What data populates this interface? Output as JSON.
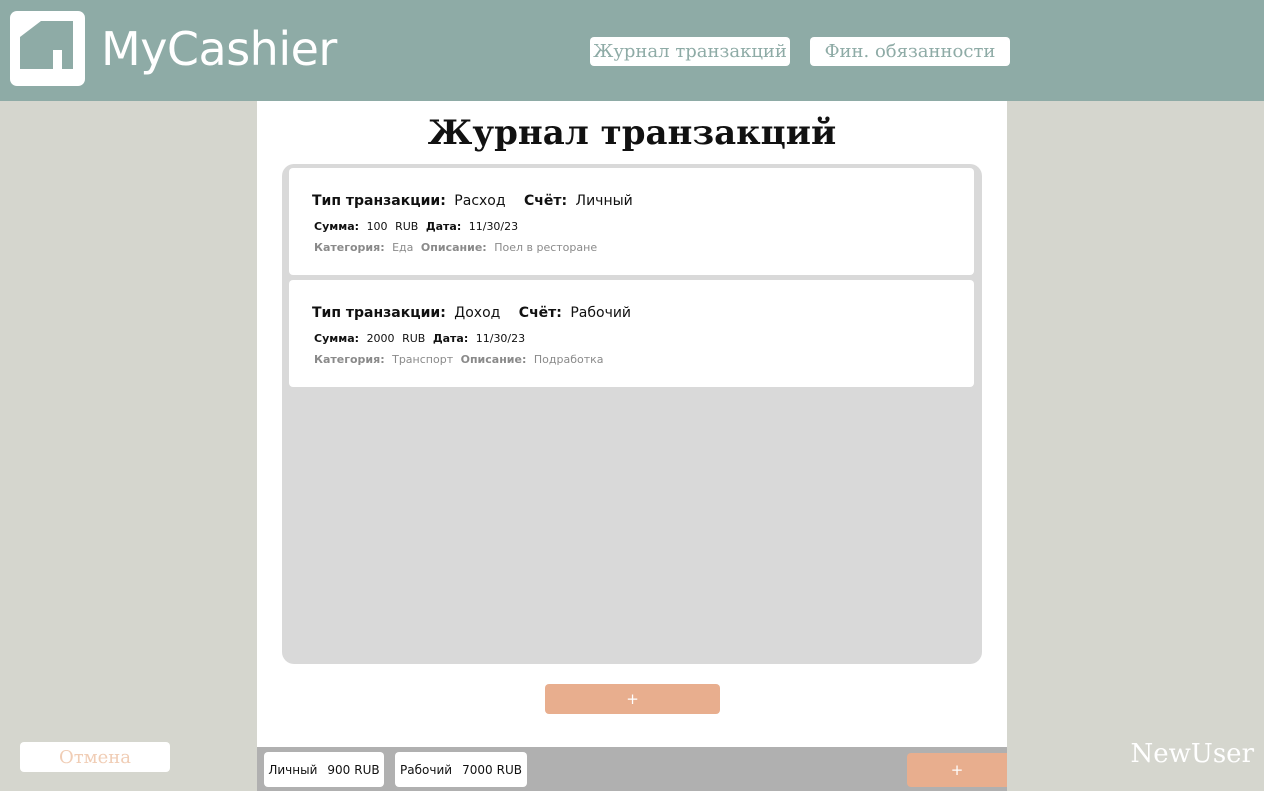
{
  "app": {
    "title": "MyCashier",
    "logo_icon": "house-icon"
  },
  "nav": {
    "journal_label": "Журнал транзакций",
    "debts_label": "Фин. обязанности"
  },
  "main": {
    "title": "Журнал транзакций",
    "add_button": "+"
  },
  "labels": {
    "type": "Тип транзакции:",
    "account": "Счёт:",
    "amount": "Сумма:",
    "date": "Дата:",
    "category": "Категория:",
    "description": "Описание:"
  },
  "transactions": [
    {
      "type": "Расход",
      "account": "Личный",
      "amount": "100",
      "currency": "RUB",
      "date": "11/30/23",
      "category": "Еда",
      "description": "Поел в ресторане"
    },
    {
      "type": "Доход",
      "account": "Рабочий",
      "amount": "2000",
      "currency": "RUB",
      "date": "11/30/23",
      "category": "Транспорт",
      "description": "Подработка"
    }
  ],
  "accounts": [
    {
      "name": "Личный",
      "balance": "900",
      "currency": "RUB"
    },
    {
      "name": "Рабочий",
      "balance": "7000",
      "currency": "RUB"
    }
  ],
  "bottom": {
    "add_account": "+",
    "cancel": "Отмена",
    "username": "NewUser"
  },
  "colors": {
    "header": "#8eaba6",
    "background": "#d5d6ce",
    "accent": "#e8ae8e",
    "list_bg": "#d9d9d9",
    "bottom_bar": "#b0b0b0"
  }
}
